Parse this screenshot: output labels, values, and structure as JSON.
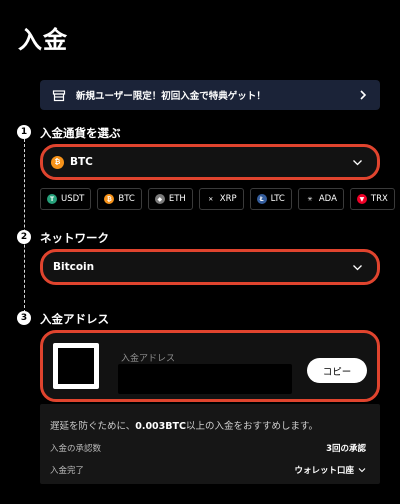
{
  "page": {
    "title": "入金"
  },
  "promo": {
    "text": "新規ユーザー限定！初回入金で特典ゲット！"
  },
  "steps": [
    {
      "number": "1",
      "label": "入金通貨を選ぶ"
    },
    {
      "number": "2",
      "label": "ネットワーク"
    },
    {
      "number": "3",
      "label": "入金アドレス"
    }
  ],
  "currency_select": {
    "value": "BTC",
    "icon": "btc-coin-icon",
    "color": "#f7931a"
  },
  "currency_chips": [
    {
      "label": "USDT",
      "icon": "usdt-icon",
      "color": "#26a17b"
    },
    {
      "label": "BTC",
      "icon": "btc-icon",
      "color": "#f7931a"
    },
    {
      "label": "ETH",
      "icon": "eth-icon",
      "color": "#7a7a7a"
    },
    {
      "label": "XRP",
      "icon": "xrp-icon",
      "color": "#000000"
    },
    {
      "label": "LTC",
      "icon": "ltc-icon",
      "color": "#345d9d"
    },
    {
      "label": "ADA",
      "icon": "ada-icon",
      "color": "#000000"
    },
    {
      "label": "TRX",
      "icon": "trx-icon",
      "color": "#ef0027"
    }
  ],
  "network_select": {
    "value": "Bitcoin"
  },
  "address": {
    "label": "入金アドレス",
    "copy_label": "コピー"
  },
  "info": {
    "warning_prefix": "遅延を防ぐために、",
    "warning_amount": "0.003BTC",
    "warning_suffix": "以上の入金をおすすめします。",
    "confirmations_label": "入金の承認数",
    "confirmations_value": "3回の承認",
    "complete_label": "入金完了",
    "complete_value": "ウォレット口座"
  },
  "colors": {
    "accent_border": "#e0442e",
    "promo_bg": "#1b2338"
  }
}
